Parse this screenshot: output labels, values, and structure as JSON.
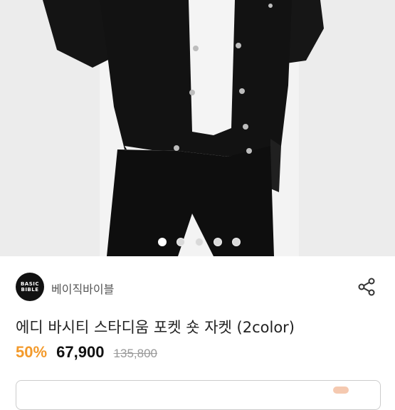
{
  "product_image": {
    "total_slides": 5,
    "active_slide": 0
  },
  "seller": {
    "logo_line1": "BASIC",
    "logo_line2": "BIBLE",
    "name": "베이직바이블"
  },
  "product": {
    "title": "에디 바시티 스타디움 포켓 숏 자켓 (2color)",
    "discount": "50%",
    "price": "67,900",
    "original_price": "135,800"
  },
  "icons": {
    "share": "share-icon"
  },
  "colors": {
    "discount": "#f39a2b",
    "price": "#111111",
    "original_price": "#999999"
  }
}
